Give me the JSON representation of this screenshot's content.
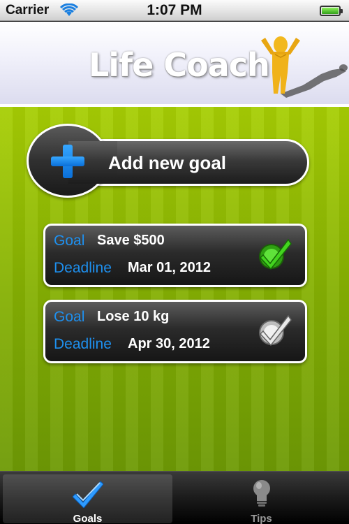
{
  "status_bar": {
    "carrier": "Carrier",
    "time": "1:07 PM",
    "wifi_icon": "wifi-icon",
    "battery_icon": "battery-full-icon"
  },
  "header": {
    "title": "Life Coach",
    "logo_icon": "life-coach-figure-logo"
  },
  "add_goal": {
    "label": "Add new goal",
    "icon": "plus-icon",
    "accent": "#1e8ff0"
  },
  "goals": [
    {
      "goal_key": "Goal",
      "goal_value": "Save $500",
      "deadline_key": "Deadline",
      "deadline_value": "Mar 01, 2012",
      "status_icon": "check-icon",
      "status_color": "#34c61a"
    },
    {
      "goal_key": "Goal",
      "goal_value": "Lose 10 kg",
      "deadline_key": "Deadline",
      "deadline_value": "Apr 30, 2012",
      "status_icon": "check-icon",
      "status_color": "#e6e6e6"
    }
  ],
  "tab_bar": {
    "tabs": [
      {
        "label": "Goals",
        "icon": "checkmark-icon",
        "selected": true
      },
      {
        "label": "Tips",
        "icon": "lightbulb-icon",
        "selected": false
      }
    ]
  },
  "colors": {
    "background_green": "#8db804",
    "key_blue": "#1e90ef"
  }
}
